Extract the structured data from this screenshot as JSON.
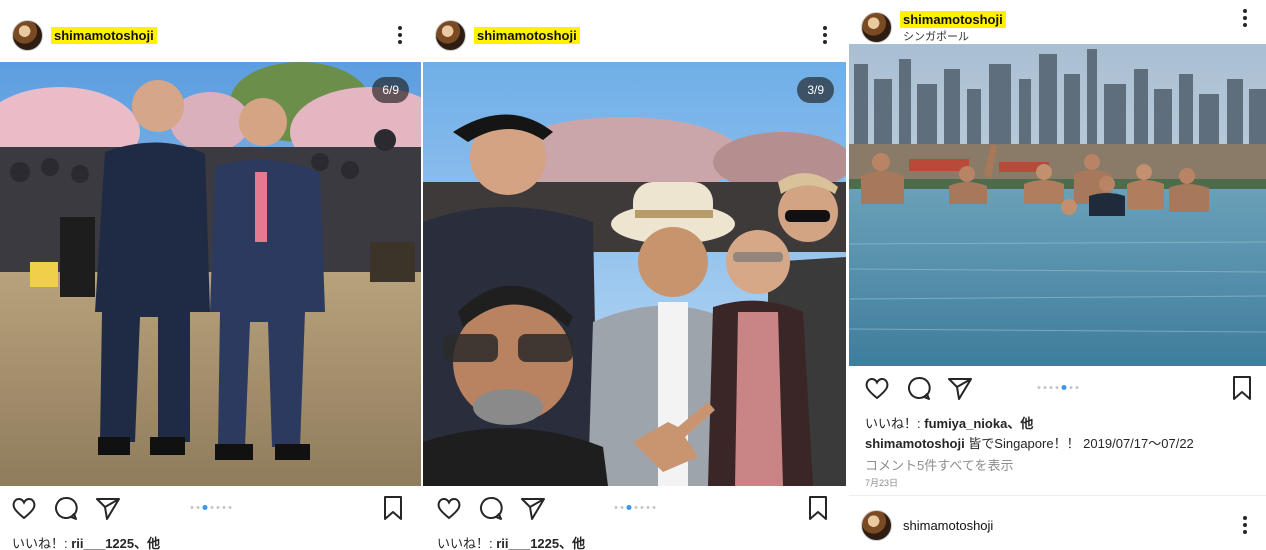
{
  "posts": [
    {
      "username": "shimamotoshoji",
      "counter": "6/9",
      "likes_prefix": "いいね！: ",
      "likes_user": "rii___1225",
      "likes_suffix": "、他",
      "carousel_active": 2,
      "carousel_total": 7
    },
    {
      "username": "shimamotoshoji",
      "counter": "3/9",
      "likes_prefix": "いいね！: ",
      "likes_user": "rii___1225",
      "likes_suffix": "、他",
      "carousel_active": 2,
      "carousel_total": 7
    },
    {
      "username": "shimamotoshoji",
      "location": "シンガポール",
      "likes_prefix": "いいね！: ",
      "likes_user": "fumiya_nioka",
      "likes_suffix": "、他",
      "caption_user": "shimamotoshoji",
      "caption_text": " 皆でSingapore！！ 2019/07/17〜07/22",
      "comments_link": "コメント5件すべてを表示",
      "date": "7月23日",
      "carousel_active": 4,
      "carousel_total": 7
    }
  ],
  "next_post": {
    "username": "shimamotoshoji"
  },
  "icons": [
    "heart-icon",
    "comment-icon",
    "share-icon",
    "bookmark-icon",
    "more-options-icon"
  ],
  "colors": {
    "highlight": "#fff200",
    "active_dot": "#3897f0",
    "text": "#262626",
    "muted": "#8e8e8e"
  }
}
